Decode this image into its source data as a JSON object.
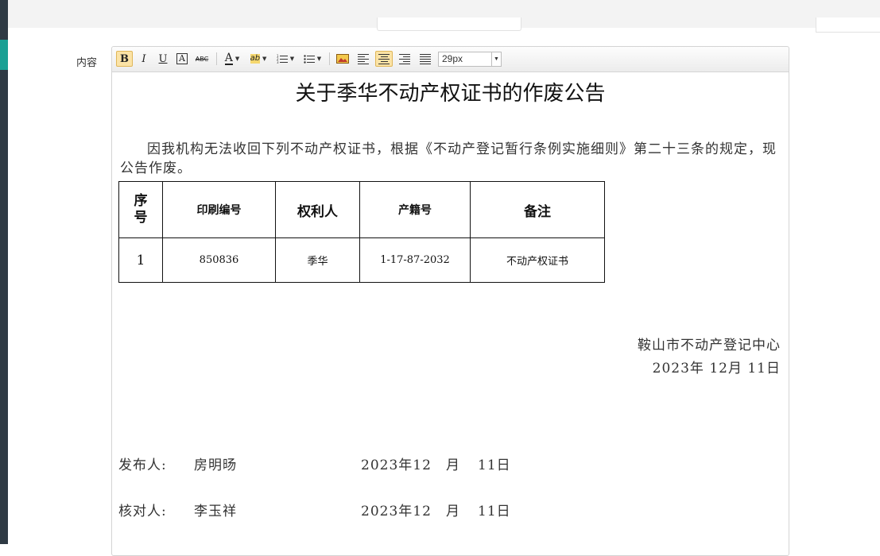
{
  "form": {
    "field_label": "内容"
  },
  "toolbar": {
    "bold": "B",
    "italic": "I",
    "underline": "U",
    "border_a": "A",
    "strike": "ABC",
    "font_color": "A",
    "highlight": "ab",
    "font_size": "29px"
  },
  "document": {
    "title": "关于季华不动产权证书的作废公告",
    "intro": "因我机构无法收回下列不动产权证书，根据《不动产登记暂行条例实施细则》第二十三条的规定，现公告作废。",
    "table": {
      "headers": [
        "序号",
        "印刷编号",
        "权利人",
        "产籍号",
        "备注"
      ],
      "rows": [
        [
          "1",
          "850836",
          "季华",
          "1-17-87-2032",
          "不动产权证书"
        ]
      ]
    },
    "signoff": {
      "org": "鞍山市不动产登记中心",
      "date": "2023年 12月 11日"
    },
    "signatures": [
      {
        "role": "发布人:",
        "name": "房明旸",
        "date_year": "2023年12",
        "date_month": "月",
        "date_day": "11日"
      },
      {
        "role": "核对人:",
        "name": "李玉祥",
        "date_year": "2023年12",
        "date_month": "月",
        "date_day": "11日"
      }
    ]
  }
}
